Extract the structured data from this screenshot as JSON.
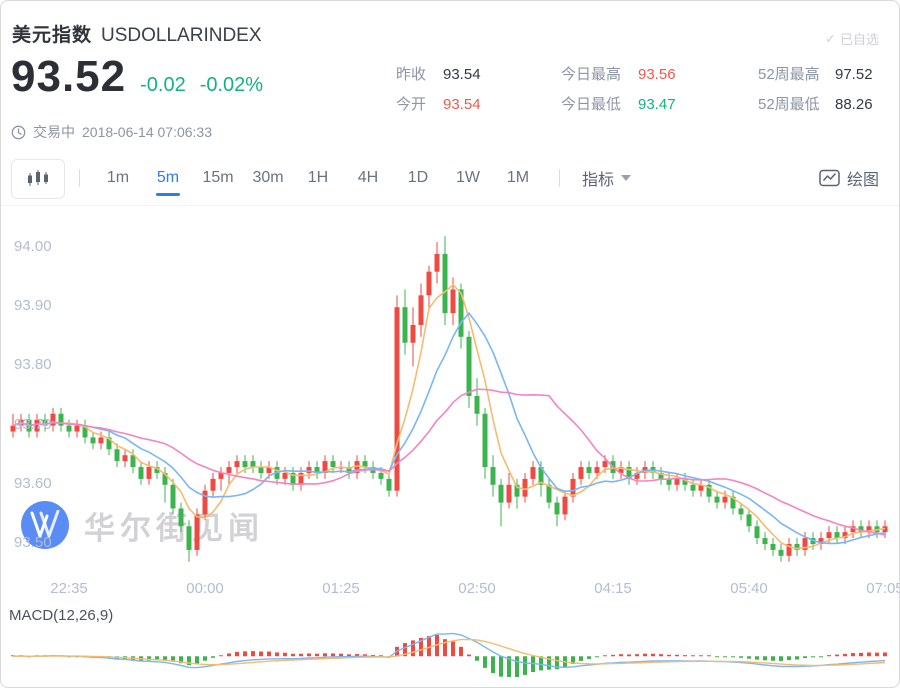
{
  "header": {
    "title_cn": "美元指数",
    "title_en": "USDOLLARINDEX",
    "check_icon": "✓",
    "watchlist": "已自选",
    "price": "93.52",
    "change": "-0.02",
    "change_pct": "-0.02%",
    "status": "交易中",
    "datetime": "2018-06-14 07:06:33",
    "stats": [
      {
        "label": "昨收",
        "value": "93.54",
        "color": "dark"
      },
      {
        "label": "今开",
        "value": "93.54",
        "color": "red"
      },
      {
        "label": "今日最高",
        "value": "93.56",
        "color": "red"
      },
      {
        "label": "今日最低",
        "value": "93.47",
        "color": "green"
      },
      {
        "label": "52周最高",
        "value": "97.52",
        "color": "dark"
      },
      {
        "label": "52周最低",
        "value": "88.26",
        "color": "dark"
      }
    ]
  },
  "toolbar": {
    "chart_type_icon": "candlestick-icon",
    "intervals": [
      {
        "label": "1m",
        "active": false
      },
      {
        "label": "5m",
        "active": true
      },
      {
        "label": "15m",
        "active": false
      },
      {
        "label": "30m",
        "active": false
      },
      {
        "label": "1H",
        "active": false
      },
      {
        "label": "4H",
        "active": false
      },
      {
        "label": "1D",
        "active": false
      },
      {
        "label": "1W",
        "active": false
      },
      {
        "label": "1M",
        "active": false
      }
    ],
    "indicator_label": "指标",
    "draw_label": "绘图"
  },
  "watermark": {
    "text": "华尔街见闻"
  },
  "macd_label": "MACD(12,26,9)",
  "colors": {
    "up": "#ef4a42",
    "down": "#3cb44e",
    "ma5": "#f7bb6e",
    "ma10": "#7ab6f5",
    "ma20": "#f584c3",
    "accent": "#2f7bf2",
    "text_green": "#13b380",
    "text_red": "#f5564c",
    "text_dark": "#333a45",
    "axis_label": "#b2bcd2"
  },
  "chart_data": {
    "type": "candlestick",
    "title": "美元指数 USDOLLARINDEX 5m",
    "interval": "5m",
    "x_ticks": [
      "22:35",
      "00:00",
      "01:25",
      "02:50",
      "04:15",
      "05:40",
      "07:05"
    ],
    "x_tick_indices": [
      7,
      24,
      41,
      58,
      75,
      92,
      109
    ],
    "y_ticks": [
      "94.00",
      "93.90",
      "93.80",
      "93.70",
      "93.60",
      "93.50"
    ],
    "ylim": [
      93.44,
      94.06
    ],
    "grid": false,
    "ma_periods": [
      5,
      10,
      20
    ],
    "macd_params": [
      12,
      26,
      9
    ],
    "candles": [
      [
        93.69,
        93.72,
        93.68,
        93.7
      ],
      [
        93.7,
        93.72,
        93.69,
        93.71
      ],
      [
        93.71,
        93.72,
        93.68,
        93.69
      ],
      [
        93.69,
        93.72,
        93.68,
        93.71
      ],
      [
        93.71,
        93.72,
        93.69,
        93.7
      ],
      [
        93.7,
        93.73,
        93.69,
        93.72
      ],
      [
        93.72,
        93.73,
        93.69,
        93.7
      ],
      [
        93.7,
        93.71,
        93.68,
        93.69
      ],
      [
        93.69,
        93.71,
        93.68,
        93.7
      ],
      [
        93.7,
        93.71,
        93.67,
        93.68
      ],
      [
        93.68,
        93.69,
        93.66,
        93.67
      ],
      [
        93.67,
        93.69,
        93.66,
        93.68
      ],
      [
        93.68,
        93.69,
        93.65,
        93.66
      ],
      [
        93.66,
        93.67,
        93.63,
        93.64
      ],
      [
        93.64,
        93.66,
        93.63,
        93.65
      ],
      [
        93.65,
        93.66,
        93.62,
        93.63
      ],
      [
        93.63,
        93.64,
        93.6,
        93.61
      ],
      [
        93.61,
        93.64,
        93.6,
        93.63
      ],
      [
        93.63,
        93.64,
        93.61,
        93.62
      ],
      [
        93.62,
        93.63,
        93.57,
        93.6
      ],
      [
        93.6,
        93.61,
        93.55,
        93.56
      ],
      [
        93.56,
        93.57,
        93.52,
        93.53
      ],
      [
        93.53,
        93.54,
        93.47,
        93.49
      ],
      [
        93.49,
        93.56,
        93.48,
        93.55
      ],
      [
        93.55,
        93.6,
        93.54,
        93.59
      ],
      [
        93.59,
        93.62,
        93.58,
        93.61
      ],
      [
        93.61,
        93.63,
        93.59,
        93.62
      ],
      [
        93.62,
        93.64,
        93.6,
        93.63
      ],
      [
        93.63,
        93.65,
        93.62,
        93.64
      ],
      [
        93.64,
        93.65,
        93.62,
        93.63
      ],
      [
        93.64,
        93.65,
        93.62,
        93.63
      ],
      [
        93.63,
        93.64,
        93.61,
        93.62
      ],
      [
        93.62,
        93.64,
        93.61,
        93.63
      ],
      [
        93.63,
        93.64,
        93.6,
        93.61
      ],
      [
        93.61,
        93.63,
        93.6,
        93.62
      ],
      [
        93.62,
        93.63,
        93.59,
        93.6
      ],
      [
        93.6,
        93.63,
        93.59,
        93.62
      ],
      [
        93.62,
        93.64,
        93.61,
        93.63
      ],
      [
        93.63,
        93.64,
        93.61,
        93.62
      ],
      [
        93.62,
        93.65,
        93.61,
        93.64
      ],
      [
        93.64,
        93.65,
        93.62,
        93.63
      ],
      [
        93.63,
        93.64,
        93.62,
        93.63
      ],
      [
        93.63,
        93.64,
        93.61,
        93.62
      ],
      [
        93.62,
        93.65,
        93.61,
        93.64
      ],
      [
        93.64,
        93.65,
        93.62,
        93.63
      ],
      [
        93.63,
        93.64,
        93.61,
        93.62
      ],
      [
        93.62,
        93.63,
        93.6,
        93.61
      ],
      [
        93.61,
        93.62,
        93.58,
        93.59
      ],
      [
        93.59,
        93.92,
        93.58,
        93.9
      ],
      [
        93.9,
        93.93,
        93.82,
        93.84
      ],
      [
        93.84,
        93.9,
        93.8,
        93.87
      ],
      [
        93.87,
        93.94,
        93.85,
        93.92
      ],
      [
        93.92,
        93.97,
        93.9,
        93.96
      ],
      [
        93.96,
        94.01,
        93.94,
        93.99
      ],
      [
        93.99,
        94.02,
        93.87,
        93.89
      ],
      [
        93.89,
        93.95,
        93.87,
        93.93
      ],
      [
        93.93,
        93.94,
        93.83,
        93.85
      ],
      [
        93.85,
        93.86,
        93.73,
        93.75
      ],
      [
        93.75,
        93.78,
        93.7,
        93.72
      ],
      [
        93.72,
        93.73,
        93.61,
        93.63
      ],
      [
        93.63,
        93.65,
        93.58,
        93.6
      ],
      [
        93.6,
        93.61,
        93.53,
        93.57
      ],
      [
        93.57,
        93.62,
        93.56,
        93.6
      ],
      [
        93.6,
        93.61,
        93.56,
        93.58
      ],
      [
        93.58,
        93.62,
        93.57,
        93.61
      ],
      [
        93.61,
        93.64,
        93.6,
        93.63
      ],
      [
        93.63,
        93.64,
        93.58,
        93.6
      ],
      [
        93.6,
        93.61,
        93.56,
        93.57
      ],
      [
        93.57,
        93.58,
        93.53,
        93.55
      ],
      [
        93.55,
        93.59,
        93.54,
        93.58
      ],
      [
        93.58,
        93.62,
        93.57,
        93.61
      ],
      [
        93.61,
        93.64,
        93.6,
        93.63
      ],
      [
        93.63,
        93.64,
        93.61,
        93.62
      ],
      [
        93.62,
        93.64,
        93.61,
        93.63
      ],
      [
        93.63,
        93.65,
        93.62,
        93.64
      ],
      [
        93.64,
        93.65,
        93.61,
        93.62
      ],
      [
        93.62,
        93.64,
        93.61,
        93.63
      ],
      [
        93.63,
        93.64,
        93.6,
        93.61
      ],
      [
        93.61,
        93.63,
        93.6,
        93.62
      ],
      [
        93.62,
        93.64,
        93.61,
        93.63
      ],
      [
        93.63,
        93.64,
        93.61,
        93.62
      ],
      [
        93.62,
        93.63,
        93.6,
        93.61
      ],
      [
        93.61,
        93.62,
        93.59,
        93.6
      ],
      [
        93.6,
        93.62,
        93.59,
        93.61
      ],
      [
        93.61,
        93.62,
        93.59,
        93.6
      ],
      [
        93.6,
        93.61,
        93.58,
        93.59
      ],
      [
        93.59,
        93.61,
        93.58,
        93.6
      ],
      [
        93.6,
        93.61,
        93.57,
        93.58
      ],
      [
        93.58,
        93.59,
        93.56,
        93.57
      ],
      [
        93.57,
        93.59,
        93.56,
        93.58
      ],
      [
        93.58,
        93.59,
        93.55,
        93.56
      ],
      [
        93.56,
        93.57,
        93.54,
        93.55
      ],
      [
        93.55,
        93.56,
        93.52,
        93.53
      ],
      [
        93.53,
        93.54,
        93.5,
        93.51
      ],
      [
        93.51,
        93.52,
        93.49,
        93.5
      ],
      [
        93.5,
        93.51,
        93.48,
        93.49
      ],
      [
        93.49,
        93.5,
        93.47,
        93.48
      ],
      [
        93.48,
        93.51,
        93.47,
        93.5
      ],
      [
        93.5,
        93.51,
        93.48,
        93.49
      ],
      [
        93.49,
        93.52,
        93.48,
        93.51
      ],
      [
        93.51,
        93.52,
        93.49,
        93.5
      ],
      [
        93.5,
        93.52,
        93.49,
        93.51
      ],
      [
        93.51,
        93.53,
        93.5,
        93.52
      ],
      [
        93.52,
        93.53,
        93.5,
        93.51
      ],
      [
        93.51,
        93.53,
        93.5,
        93.52
      ],
      [
        93.52,
        93.54,
        93.51,
        93.53
      ],
      [
        93.53,
        93.54,
        93.51,
        93.52
      ],
      [
        93.52,
        93.54,
        93.51,
        93.53
      ],
      [
        93.53,
        93.54,
        93.51,
        93.52
      ],
      [
        93.52,
        93.54,
        93.51,
        93.53
      ]
    ]
  }
}
